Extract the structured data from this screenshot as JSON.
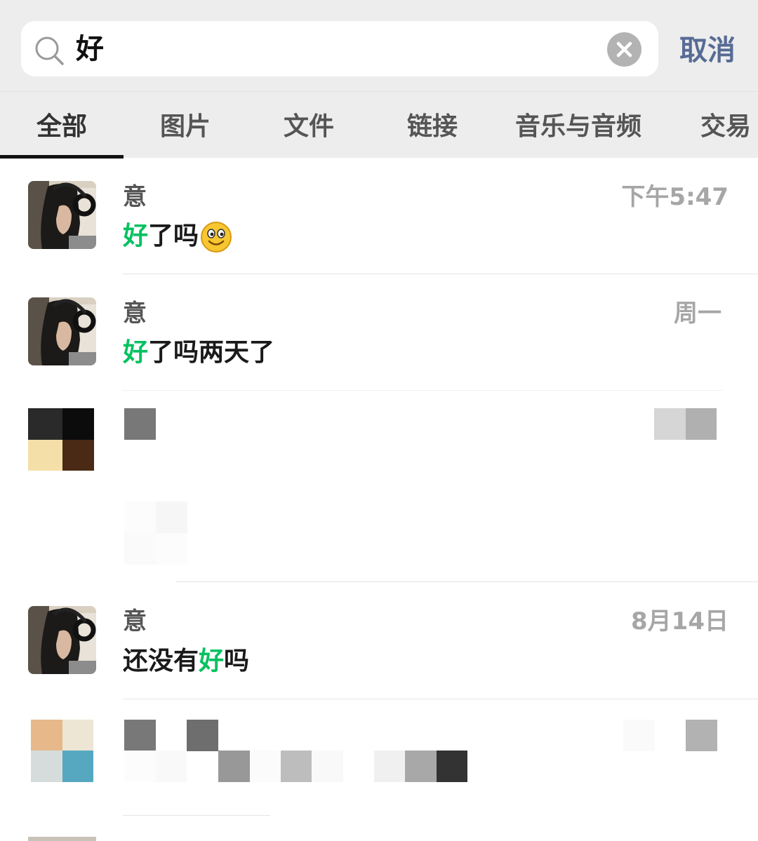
{
  "search": {
    "query": "好",
    "cancel_label": "取消"
  },
  "tabs": [
    {
      "label": "全部",
      "active": true
    },
    {
      "label": "图片"
    },
    {
      "label": "文件"
    },
    {
      "label": "链接"
    },
    {
      "label": "音乐与音频"
    },
    {
      "label": "交易"
    }
  ],
  "results": [
    {
      "name": "意",
      "time": "下午5:47",
      "msg_highlight": "好",
      "msg_rest": "了吗",
      "emoji": "smiley-icon"
    },
    {
      "name": "意",
      "time": "周一",
      "msg_highlight": "好",
      "msg_rest": "了吗两天了"
    },
    {
      "name": "",
      "time": "",
      "censored": true
    },
    {
      "name": "意",
      "time": "8月14日",
      "msg_before": "还没有",
      "msg_highlight": "好",
      "msg_after": "吗"
    },
    {
      "name": "",
      "time": "",
      "censored": true
    }
  ],
  "colors": {
    "accent_green": "#07c160",
    "link_blue": "#576b95",
    "header_bg": "#ededed"
  }
}
